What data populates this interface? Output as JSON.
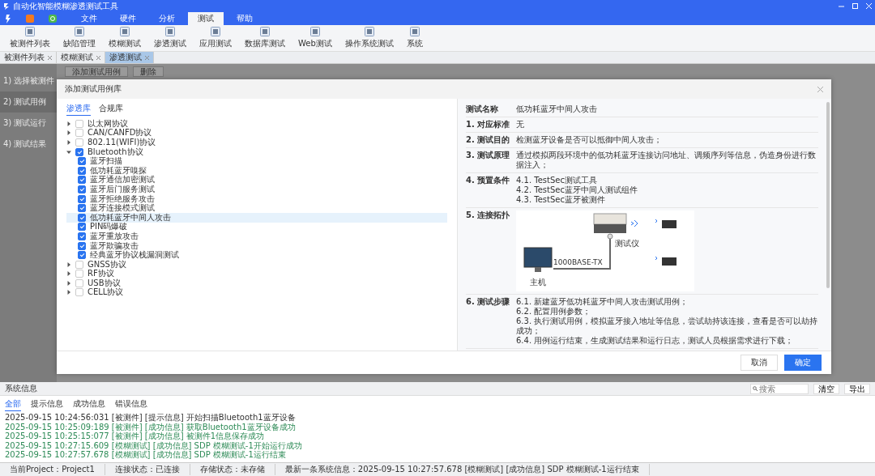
{
  "window": {
    "title": "自动化智能模糊渗透测试工具"
  },
  "menu_tabs": [
    {
      "label": "文件",
      "selected": false
    },
    {
      "label": "硬件",
      "selected": false
    },
    {
      "label": "分析",
      "selected": false
    },
    {
      "label": "测试",
      "selected": true
    },
    {
      "label": "帮助",
      "selected": false
    }
  ],
  "toolbar": [
    "被测件列表",
    "缺陷管理",
    "模糊测试",
    "渗透测试",
    "应用测试",
    "数据库测试",
    "Web测试",
    "操作系统测试",
    "系统"
  ],
  "doc_tabs": [
    {
      "label": "被测件列表",
      "selected": false
    },
    {
      "label": "模糊测试",
      "selected": false
    },
    {
      "label": "渗透测试",
      "selected": true
    }
  ],
  "steps": [
    {
      "label": "1) 选择被测件",
      "selected": false
    },
    {
      "label": "2) 测试用例",
      "selected": true
    },
    {
      "label": "3) 测试运行",
      "selected": false
    },
    {
      "label": "4) 测试结果",
      "selected": false
    }
  ],
  "content_buttons": [
    "添加测试用例",
    "删除"
  ],
  "dialog": {
    "title": "添加测试用例库",
    "tabs": [
      {
        "label": "渗透库",
        "selected": true
      },
      {
        "label": "合规库",
        "selected": false
      }
    ],
    "tree": [
      {
        "label": "以太网协议",
        "checked": false,
        "expanded": false,
        "selected": false
      },
      {
        "label": "CAN/CANFD协议",
        "checked": false,
        "expanded": false,
        "selected": false
      },
      {
        "label": "802.11(WIFI)协议",
        "checked": false,
        "expanded": false,
        "selected": false
      },
      {
        "label": "Bluetooth协议",
        "checked": true,
        "expanded": true,
        "selected": false,
        "children": [
          {
            "label": "蓝牙扫描",
            "checked": true,
            "selected": false
          },
          {
            "label": "低功耗蓝牙嗅探",
            "checked": true,
            "selected": false
          },
          {
            "label": "蓝牙通信加密测试",
            "checked": true,
            "selected": false
          },
          {
            "label": "蓝牙后门服务测试",
            "checked": true,
            "selected": false
          },
          {
            "label": "蓝牙拒绝服务攻击",
            "checked": true,
            "selected": false
          },
          {
            "label": "蓝牙连接模式测试",
            "checked": true,
            "selected": false
          },
          {
            "label": "低功耗蓝牙中间人攻击",
            "checked": true,
            "selected": true
          },
          {
            "label": "PIN码爆破",
            "checked": true,
            "selected": false
          },
          {
            "label": "蓝牙重放攻击",
            "checked": true,
            "selected": false
          },
          {
            "label": "蓝牙欺骗攻击",
            "checked": true,
            "selected": false
          },
          {
            "label": "经典蓝牙协议栈漏洞测试",
            "checked": true,
            "selected": false
          }
        ]
      },
      {
        "label": "GNSS协议",
        "checked": false,
        "expanded": false,
        "selected": false
      },
      {
        "label": "RF协议",
        "checked": false,
        "expanded": false,
        "selected": false
      },
      {
        "label": "USB协议",
        "checked": false,
        "expanded": false,
        "selected": false
      },
      {
        "label": "CELL协议",
        "checked": false,
        "expanded": false,
        "selected": false
      }
    ],
    "details": [
      {
        "kind": "text",
        "label": "测试名称",
        "lines": [
          "低功耗蓝牙中间人攻击"
        ]
      },
      {
        "kind": "text",
        "label": "1. 对应标准",
        "lines": [
          "无"
        ]
      },
      {
        "kind": "text",
        "label": "2. 测试目的",
        "lines": [
          "检测蓝牙设备是否可以抵御中间人攻击；"
        ]
      },
      {
        "kind": "text",
        "label": "3. 测试原理",
        "lines": [
          "通过模拟两段环境中的低功耗蓝牙连接访问地址、调频序列等信息，伪造身份进行数据注入；"
        ]
      },
      {
        "kind": "text",
        "label": "4. 预置条件",
        "lines": [
          "4.1. TestSec测试工具",
          "4.2. TestSec蓝牙中间人测试组件",
          "4.3. TestSec蓝牙被测件"
        ]
      },
      {
        "kind": "diagram",
        "label": "5. 连接拓扑",
        "labels": [
          "测试仪",
          "1000BASE-TX",
          "主机"
        ]
      },
      {
        "kind": "text",
        "label": "6. 测试步骤",
        "lines": [
          "6.1. 新建蓝牙低功耗蓝牙中间人攻击测试用例；",
          "6.2. 配置用例参数；",
          "6.3. 执行测试用例，模拟蓝牙接入地址等信息，尝试劫持该连接，查看是否可以劫持成功；",
          "6.4. 用例运行结束，生成测试结果和运行日志，测试人员根据需求进行下载；"
        ]
      }
    ],
    "buttons": [
      {
        "label": "取消",
        "kind": "secondary"
      },
      {
        "label": "确定",
        "kind": "primary"
      }
    ]
  },
  "log_panel": {
    "title": "系统信息",
    "search": {
      "placeholder": "搜索"
    },
    "buttons": [
      "清空",
      "导出"
    ],
    "tabs": [
      {
        "label": "全部",
        "selected": true
      },
      {
        "label": "提示信息",
        "selected": false
      },
      {
        "label": "成功信息",
        "selected": false
      },
      {
        "label": "错误信息",
        "selected": false
      }
    ],
    "lines": [
      {
        "kind": "info",
        "text": "2025-09-15 10:24:56:031 [被测件] [提示信息] 开始扫描Bluetooth1蓝牙设备"
      },
      {
        "kind": "success",
        "text": "2025-09-15 10:25:09:189 [被测件] [成功信息] 获取Bluetooth1蓝牙设备成功"
      },
      {
        "kind": "success",
        "text": "2025-09-15 10:25:15:077 [被测件] [成功信息] 被测件1信息保存成功"
      },
      {
        "kind": "success",
        "text": "2025-09-15 10:27:15.609 [模糊测试] [成功信息] SDP 模糊测试-1开始运行成功"
      },
      {
        "kind": "success",
        "text": "2025-09-15 10:27:57.678 [模糊测试] [成功信息] SDP 模糊测试-1运行结束"
      }
    ]
  },
  "status_bar": [
    "当前Project：Project1",
    "连接状态：已连接",
    "存储状态：未存储",
    "最新一条系统信息：2025-09-15 10:27:57.678 [模糊测试] [成功信息] SDP 模糊测试-1运行结束"
  ]
}
